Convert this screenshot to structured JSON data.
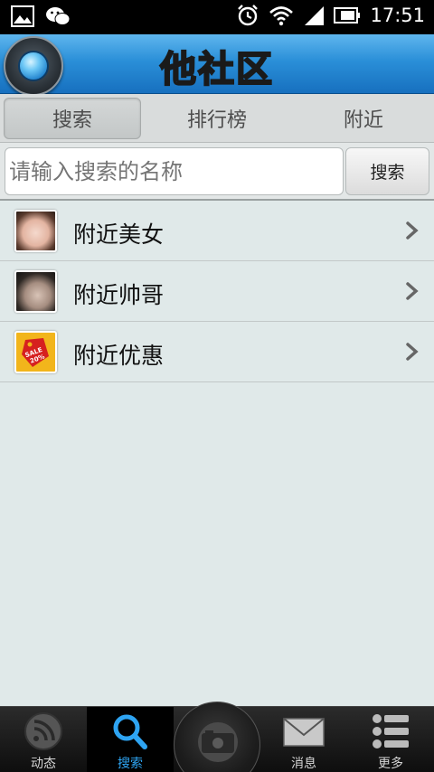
{
  "status_bar": {
    "time": "17:51"
  },
  "header": {
    "title_parts": [
      "他",
      "社",
      "区"
    ]
  },
  "tabs": [
    {
      "label": "搜索",
      "active": true
    },
    {
      "label": "排行榜",
      "active": false
    },
    {
      "label": "附近",
      "active": false
    }
  ],
  "search": {
    "placeholder": "请输入搜索的名称",
    "button_label": "搜索"
  },
  "list": [
    {
      "label": "附近美女",
      "icon": "female-avatar-icon"
    },
    {
      "label": "附近帅哥",
      "icon": "male-avatar-icon"
    },
    {
      "label": "附近优惠",
      "icon": "sale-tag-icon"
    }
  ],
  "sale_tag": {
    "line1": "SALE",
    "line2": "20%"
  },
  "tab_bar": {
    "items": [
      {
        "label": "动态",
        "icon": "rss-icon",
        "active": false
      },
      {
        "label": "搜索",
        "icon": "search-icon",
        "active": true
      },
      {
        "label": "",
        "icon": "camera-icon",
        "active": false
      },
      {
        "label": "消息",
        "icon": "envelope-icon",
        "active": false
      },
      {
        "label": "更多",
        "icon": "list-icon",
        "active": false
      }
    ]
  },
  "colors": {
    "accent": "#2ea4f2",
    "header": "#2a8fd8",
    "background": "#e0e9e9"
  }
}
